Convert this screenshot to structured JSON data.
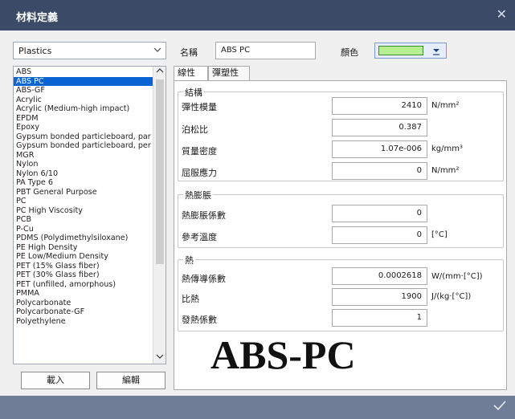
{
  "window": {
    "title": "材料定義",
    "close_glyph": "✕"
  },
  "category": {
    "selected": "Plastics"
  },
  "materials": [
    "ABS",
    "ABS PC",
    "ABS-GF",
    "Acrylic",
    "Acrylic (Medium-high impact)",
    "EPDM",
    "Epoxy",
    "Gypsum bonded particleboard, par",
    "Gypsum bonded particleboard, per",
    "MGR",
    "Nylon",
    "Nylon 6/10",
    "PA Type 6",
    "PBT General Purpose",
    "PC",
    "PC High Viscosity",
    "PCB",
    "P-Cu",
    "PDMS (Polydimethylsiloxane)",
    "PE High Density",
    "PE Low/Medium Density",
    "PET (15% Glass fiber)",
    "PET (30% Glass fiber)",
    "PET (unfilled, amorphous)",
    "PMMA",
    "Polycarbonate",
    "Polycarbonate-GF",
    "Polyethylene"
  ],
  "selected_material_index": 1,
  "buttons": {
    "load": "載入",
    "edit": "編輯"
  },
  "name": {
    "label": "名稱",
    "value": "ABS PC"
  },
  "color": {
    "label": "顏色",
    "value": "#b8ef90",
    "dropdown_icon": "underline-down-arrow-icon"
  },
  "tabs": [
    {
      "label": "線性",
      "active": true
    },
    {
      "label": "彈塑性",
      "active": false
    }
  ],
  "structure": {
    "title": "結構",
    "rows": [
      {
        "label": "彈性模量",
        "value": "2410",
        "unit": "N/mm²"
      },
      {
        "label": "泊松比",
        "value": "0.387",
        "unit": ""
      },
      {
        "label": "質量密度",
        "value": "1.07e-006",
        "unit": "kg/mm³"
      },
      {
        "label": "屈服應力",
        "value": "0",
        "unit": "N/mm²"
      }
    ]
  },
  "thermal_expansion": {
    "title": "熱膨脹",
    "rows": [
      {
        "label": "熱膨脹係數",
        "value": "0",
        "unit": ""
      },
      {
        "label": "參考溫度",
        "value": "0",
        "unit": "[°C]"
      }
    ]
  },
  "heat": {
    "title": "熱",
    "rows": [
      {
        "label": "熱傳導係數",
        "value": "0.0002618",
        "unit": "W/(mm·[°C])"
      },
      {
        "label": "比熱",
        "value": "1900",
        "unit": "J/(kg·[°C])"
      },
      {
        "label": "發熱係數",
        "value": "1",
        "unit": ""
      }
    ]
  },
  "watermark": "ABS-PC",
  "confirm_icon": "checkmark-icon"
}
